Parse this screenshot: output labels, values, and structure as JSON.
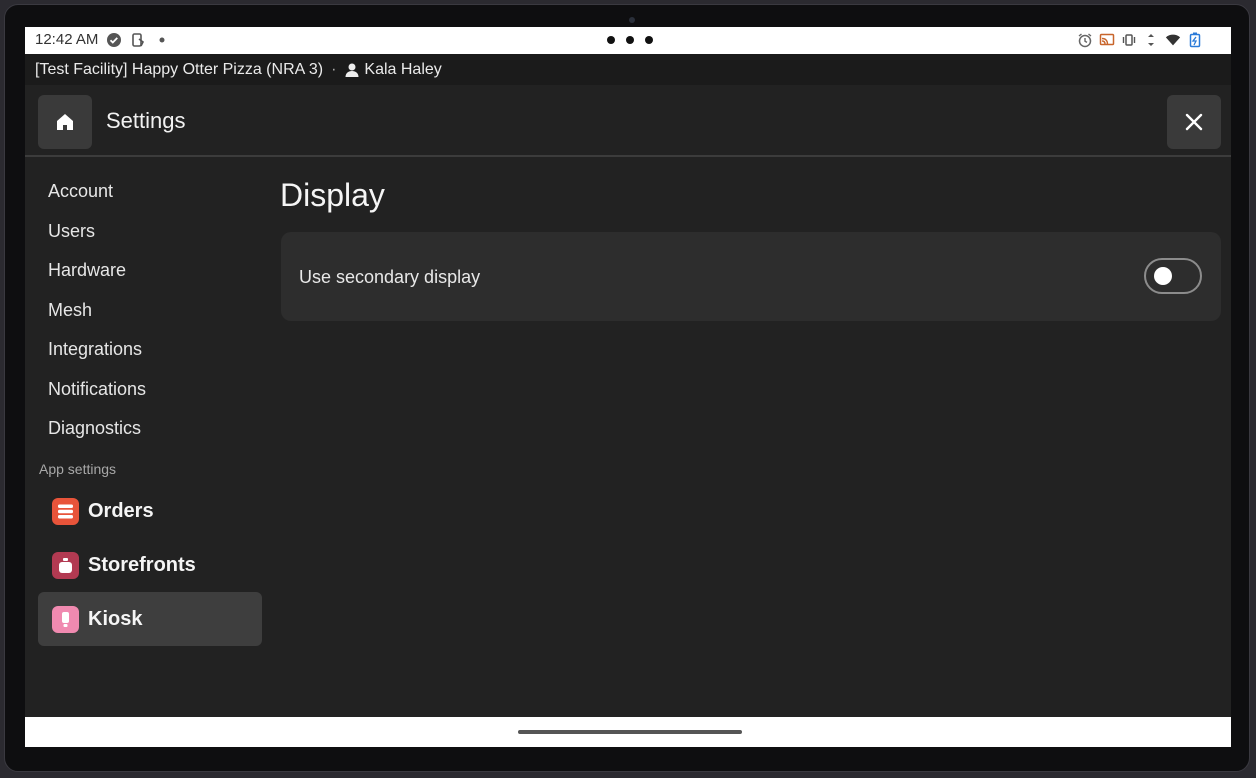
{
  "status_bar": {
    "time": "12:42 AM"
  },
  "facility_bar": {
    "facility": "[Test Facility] Happy Otter Pizza (NRA 3)",
    "separator": "·",
    "user": "Kala Haley"
  },
  "header": {
    "title": "Settings"
  },
  "sidebar": {
    "items": [
      {
        "label": "Account"
      },
      {
        "label": "Users"
      },
      {
        "label": "Hardware"
      },
      {
        "label": "Mesh"
      },
      {
        "label": "Integrations"
      },
      {
        "label": "Notifications"
      },
      {
        "label": "Diagnostics"
      }
    ],
    "section_label": "App settings",
    "apps": [
      {
        "label": "Orders",
        "icon": "orders-icon",
        "color": "#e8543a",
        "active": false
      },
      {
        "label": "Storefronts",
        "icon": "storefront-icon",
        "color": "#b23a52",
        "active": false
      },
      {
        "label": "Kiosk",
        "icon": "kiosk-icon",
        "color": "#f08ab0",
        "active": true
      }
    ]
  },
  "main": {
    "title": "Display",
    "settings": [
      {
        "label": "Use secondary display",
        "enabled": false
      }
    ]
  },
  "colors": {
    "background": "#222222",
    "card": "#2d2d2d",
    "active_item": "#3e3e3e"
  }
}
